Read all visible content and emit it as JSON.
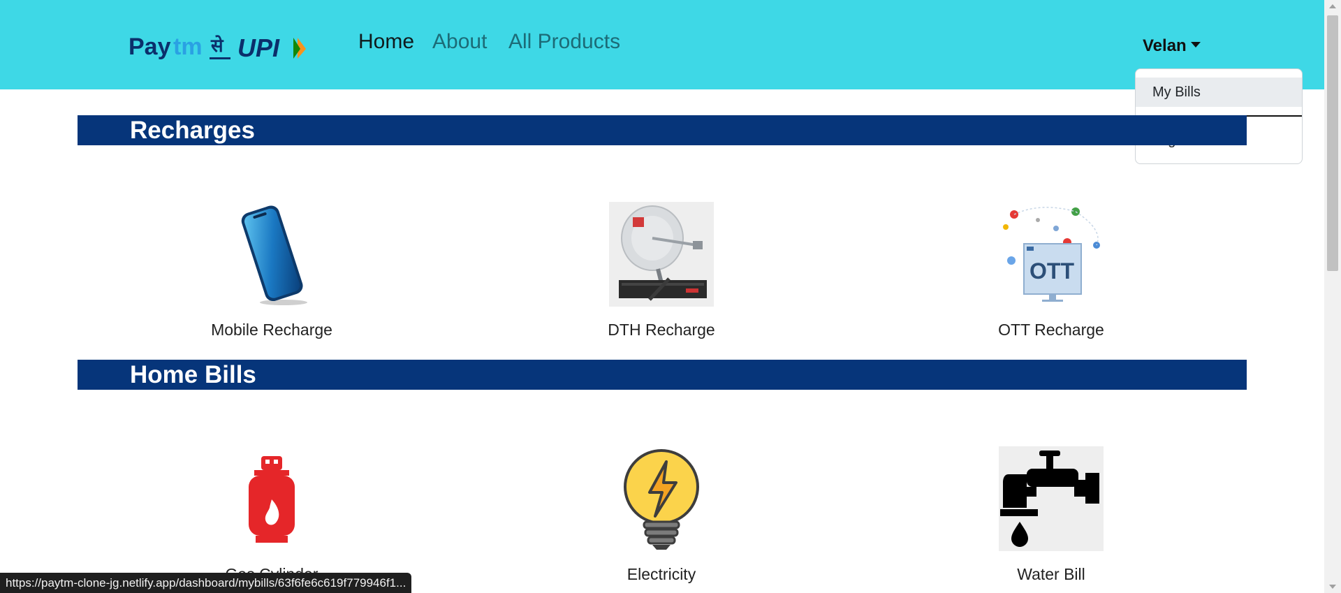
{
  "navbar": {
    "logo_alt": "Paytm से UPI",
    "links": [
      {
        "label": "Home"
      },
      {
        "label": "About"
      },
      {
        "label": "All Products"
      }
    ],
    "user": {
      "name": "Velan",
      "menu": [
        {
          "label": "My Bills"
        },
        {
          "label": "Logout"
        }
      ]
    }
  },
  "sections": [
    {
      "title": "Recharges",
      "items": [
        {
          "label": "Mobile Recharge",
          "icon": "mobile-phone-icon"
        },
        {
          "label": "DTH Recharge",
          "icon": "satellite-dish-icon"
        },
        {
          "label": "OTT Recharge",
          "icon": "ott-monitor-icon"
        }
      ]
    },
    {
      "title": "Home Bills",
      "items": [
        {
          "label": "Gas Cylinder",
          "icon": "gas-cylinder-icon"
        },
        {
          "label": "Electricity",
          "icon": "light-bulb-icon"
        },
        {
          "label": "Water Bill",
          "icon": "water-tap-icon"
        }
      ]
    }
  ],
  "status_bar": {
    "url": "https://paytm-clone-jg.netlify.app/dashboard/mybills/63f6fe6c619f779946f1..."
  },
  "colors": {
    "navbar_bg": "#3ed8e6",
    "section_bar_bg": "#06357a",
    "logo_navy": "#0b2f6b",
    "logo_accent": "#2aa1e3"
  }
}
